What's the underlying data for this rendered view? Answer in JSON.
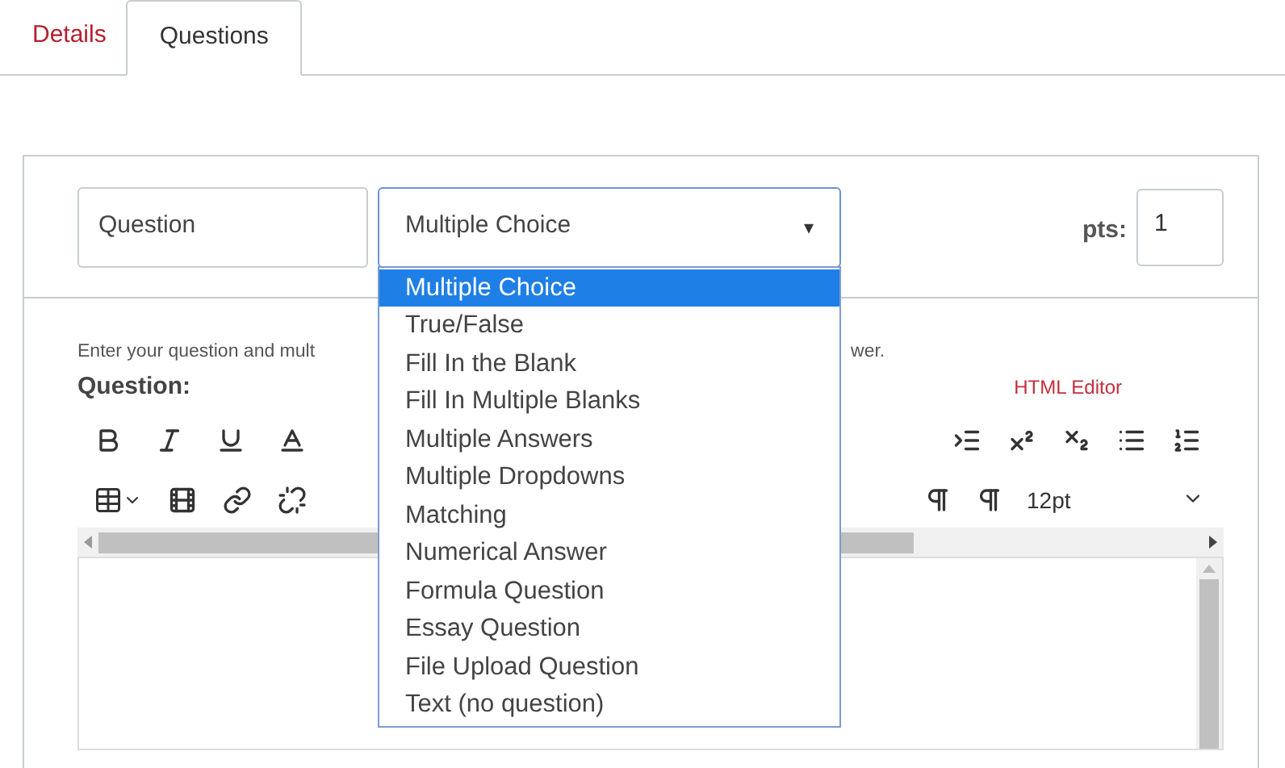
{
  "tabs": [
    {
      "label": "Details",
      "selected": false
    },
    {
      "label": "Questions",
      "selected": true
    }
  ],
  "question_header": {
    "name_field": {
      "value": "Question"
    },
    "type_select": {
      "value": "Multiple Choice",
      "caret": "▾",
      "expanded": true,
      "options": [
        {
          "label": "Multiple Choice",
          "selected": true
        },
        {
          "label": "True/False",
          "selected": false
        },
        {
          "label": "Fill In the Blank",
          "selected": false
        },
        {
          "label": "Fill In Multiple Blanks",
          "selected": false
        },
        {
          "label": "Multiple Answers",
          "selected": false
        },
        {
          "label": "Multiple Dropdowns",
          "selected": false
        },
        {
          "label": "Matching",
          "selected": false
        },
        {
          "label": "Numerical Answer",
          "selected": false
        },
        {
          "label": "Formula Question",
          "selected": false
        },
        {
          "label": "Essay Question",
          "selected": false
        },
        {
          "label": "File Upload Question",
          "selected": false
        },
        {
          "label": "Text (no question)",
          "selected": false
        }
      ]
    },
    "pts_label": "pts:",
    "pts_value": "1"
  },
  "instructions": {
    "before": "Enter your question and mult",
    "after": "wer."
  },
  "question_label": "Question:",
  "html_editor_link": "HTML Editor",
  "toolbar": {
    "font_size": "12pt"
  }
}
